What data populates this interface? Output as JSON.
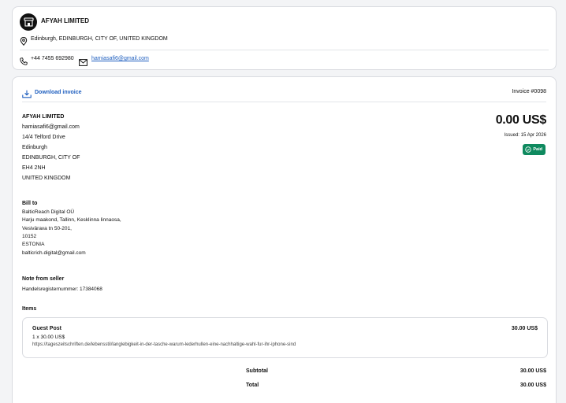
{
  "seller": {
    "name": "AFYAH LIMITED",
    "location": "Edinburgh, EDINBURGH, CITY OF, UNITED KINGDOM",
    "phone": "+44 7455 692980",
    "email": "hamiasafi6@gmail.com"
  },
  "invoice": {
    "download_label": "Download invoice",
    "number": "Invoice #0098",
    "amount": "0.00 US$",
    "issued": "Issued: 15 Apr 2026",
    "status": "Paid",
    "from": {
      "name": "AFYAH LIMITED",
      "lines": [
        "hamiasafi6@gmail.com",
        "14/4 Telford Drive",
        "Edinburgh",
        "EDINBURGH, CITY OF",
        "EH4 2NH",
        "UNITED KINGDOM"
      ]
    },
    "bill_to": {
      "title": "Bill to",
      "lines": [
        "BalticReach Digital OÜ",
        "Harju maakond, Tallinn, Kesklinna linnaosa,",
        "Vesivärava tn 50-201,",
        "10152",
        "ESTONIA",
        "balticrich.digital@gmail.com"
      ]
    },
    "note": {
      "title": "Note from seller",
      "text": "Handelsregisternummer: 17384068"
    },
    "items_title": "Items",
    "items": [
      {
        "name": "Guest Post",
        "qty_line": "1 x 30.00 US$",
        "url": "https://tageszeitschriften.de/lebensstil/langlebigkeit-in-der-tasche-warum-lederhullen-eine-nachhaltige-wahl-fur-ihr-iphone-sind",
        "price": "30.00 US$"
      }
    ],
    "subtotal_label": "Subtotal",
    "subtotal": "30.00 US$",
    "total_label": "Total",
    "total": "30.00 US$"
  },
  "colors": {
    "link": "#1f5fbf",
    "paid": "#0f8a5f",
    "logo": "#111111"
  }
}
